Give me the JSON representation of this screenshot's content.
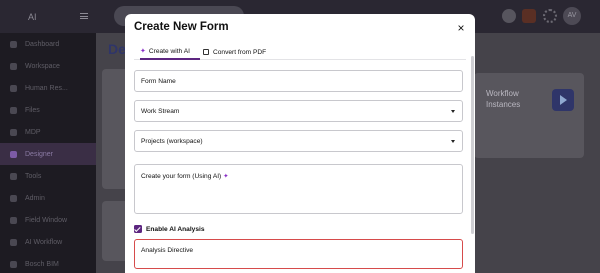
{
  "background": {
    "brand": "AI",
    "avatar_initials": "AV",
    "main_title": "De",
    "sidebar_items": [
      {
        "label": "Dashboard",
        "active": false
      },
      {
        "label": "Workspace",
        "active": false
      },
      {
        "label": "Human Res...",
        "active": false
      },
      {
        "label": "Files",
        "active": false
      },
      {
        "label": "MDP",
        "active": false
      },
      {
        "label": "Designer",
        "active": true
      },
      {
        "label": "Tools",
        "active": false
      },
      {
        "label": "Admin",
        "active": false
      },
      {
        "label": "Field Window",
        "active": false
      },
      {
        "label": "AI Workflow",
        "active": false
      },
      {
        "label": "Bosch BIM",
        "active": false
      }
    ],
    "workflow_card_label": "Workflow Instances"
  },
  "modal": {
    "title": "Create New Form",
    "close_icon": "×",
    "tabs": [
      {
        "label": "Create with AI",
        "icon": "sparkle-icon",
        "active": true
      },
      {
        "label": "Convert from PDF",
        "icon": "document-icon",
        "active": false
      }
    ],
    "form_name_placeholder": "Form Name",
    "work_stream_value": "Work Stream",
    "projects_value": "Projects (workspace)",
    "create_prompt_placeholder": "Create your form (Using AI)",
    "enable_ai_label": "Enable AI Analysis",
    "enable_ai_checked": true,
    "analysis_directive_label": "Analysis Directive"
  },
  "colors": {
    "accent": "#5d2680",
    "sparkle": "#8a2fc7",
    "error_border": "#d64b4b"
  }
}
